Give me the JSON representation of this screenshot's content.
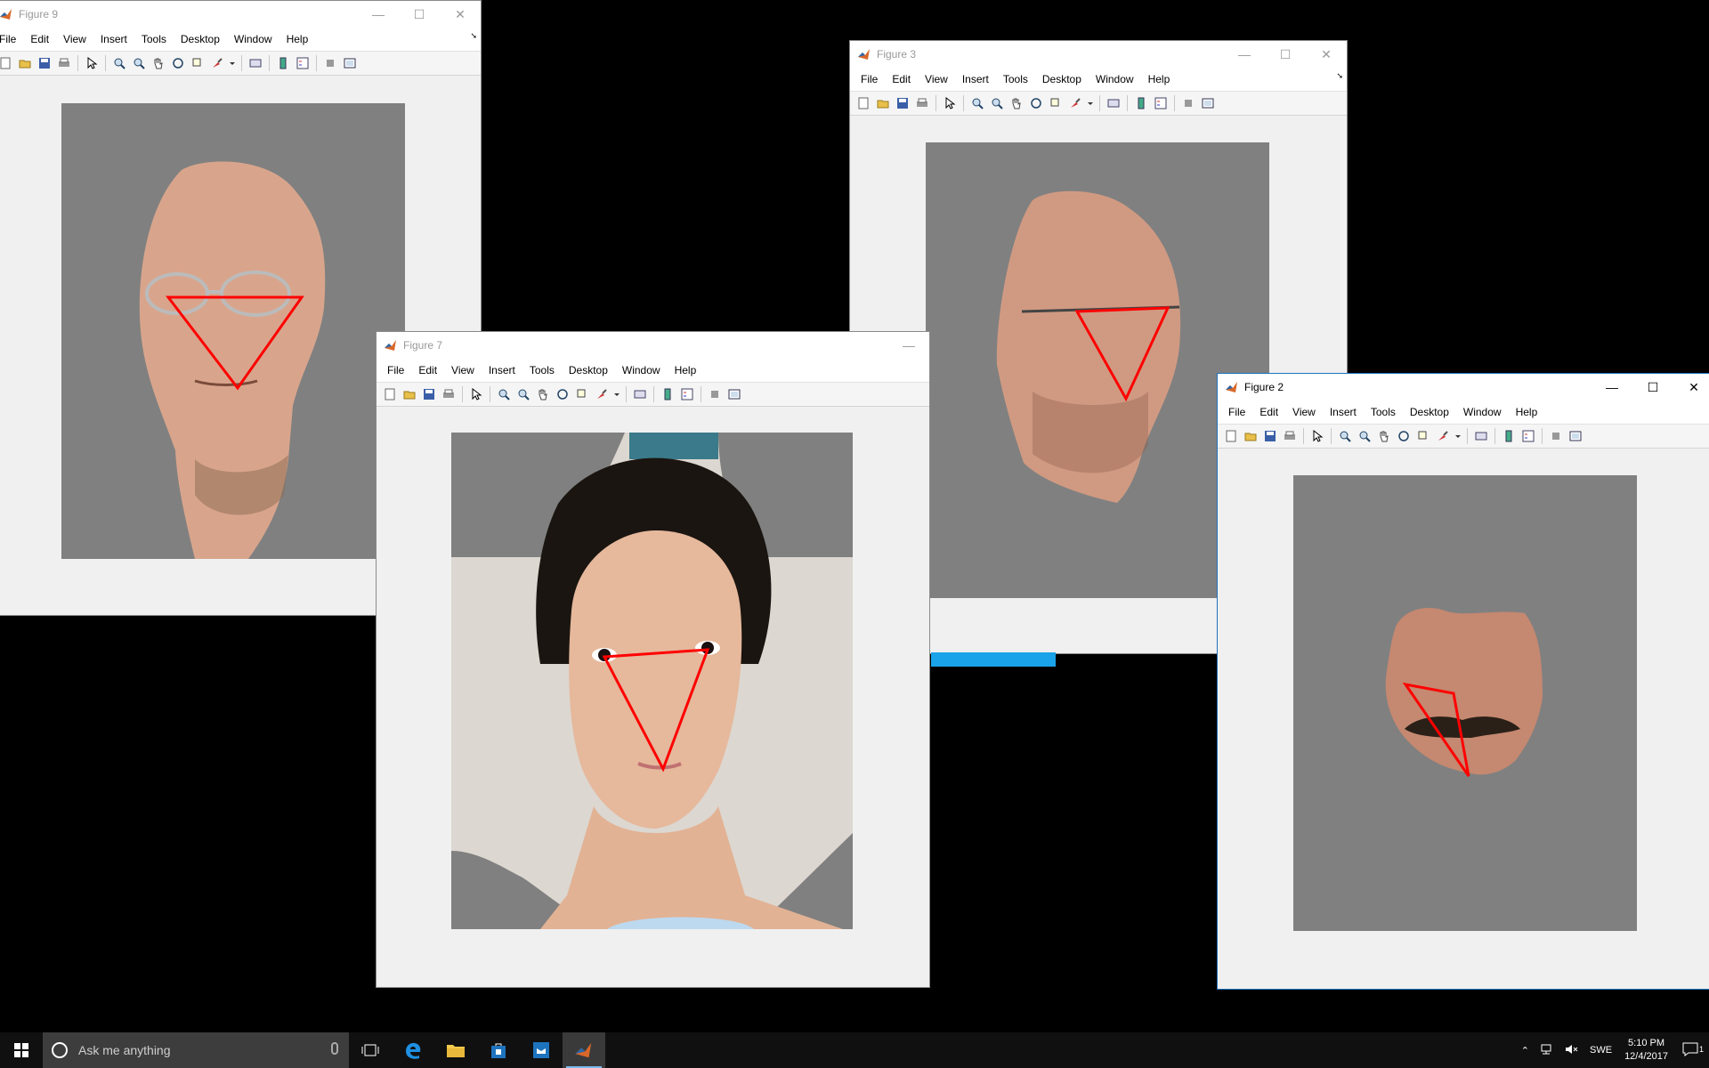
{
  "menu": [
    "File",
    "Edit",
    "View",
    "Insert",
    "Tools",
    "Desktop",
    "Window",
    "Help"
  ],
  "windows": {
    "fig9": {
      "title": "Figure 9"
    },
    "fig7": {
      "title": "Figure 7"
    },
    "fig3": {
      "title": "Figure 3"
    },
    "fig2": {
      "title": "Figure 2"
    }
  },
  "window_controls": {
    "minimize": "—",
    "maximize": "☐",
    "close": "✕"
  },
  "taskbar": {
    "search_placeholder": "Ask me anything",
    "language": "SWE",
    "time": "5:10 PM",
    "date": "12/4/2017",
    "notification_count": "1"
  },
  "colors": {
    "plot_bg": "#808080",
    "triangle": "#ff0000",
    "accent": "#1e73be"
  }
}
